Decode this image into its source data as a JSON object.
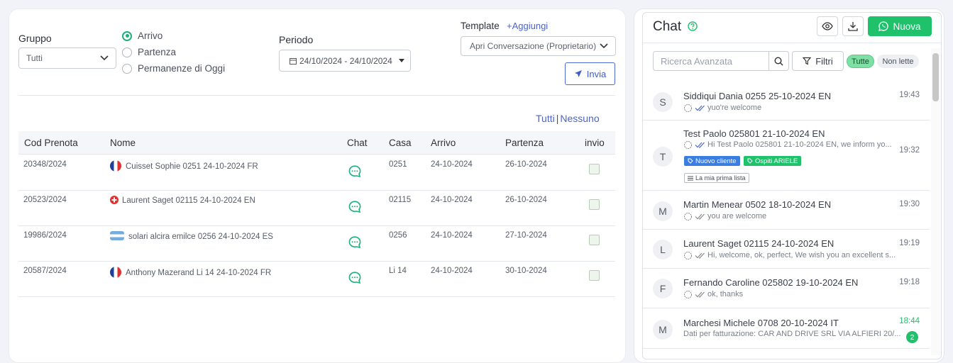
{
  "filters": {
    "gruppo_label": "Gruppo",
    "gruppo_value": "Tutti",
    "radios": [
      {
        "label": "Arrivo",
        "checked": true
      },
      {
        "label": "Partenza",
        "checked": false
      },
      {
        "label": "Permanenze di Oggi",
        "checked": false
      }
    ],
    "periodo_label": "Periodo",
    "periodo_value": "24/10/2024 - 24/10/2024",
    "template_label": "Template",
    "template_add": "+Aggiungi",
    "template_value": "Apri Conversazione (Proprietario)",
    "invia_label": "Invia"
  },
  "selection": {
    "all": "Tutti",
    "sep": "|",
    "none": "Nessuno"
  },
  "table": {
    "headers": [
      "Cod Prenota",
      "Nome",
      "Chat",
      "Casa",
      "Arrivo",
      "Partenza",
      "invio"
    ],
    "rows": [
      {
        "code": "20348/2024",
        "flag": "fr",
        "name": "Cuisset Sophie 0251 24-10-2024 FR",
        "casa": "0251",
        "arrivo": "24-10-2024",
        "partenza": "26-10-2024"
      },
      {
        "code": "20523/2024",
        "flag": "ch",
        "name": "Laurent Saget 02115 24-10-2024 EN",
        "casa": "02115",
        "arrivo": "24-10-2024",
        "partenza": "26-10-2024"
      },
      {
        "code": "19986/2024",
        "flag": "ar",
        "name": "solari alcira emilce 0256 24-10-2024 ES",
        "casa": "0256",
        "arrivo": "24-10-2024",
        "partenza": "27-10-2024"
      },
      {
        "code": "20587/2024",
        "flag": "fr",
        "name": "Anthony Mazerand Li 14 24-10-2024 FR",
        "casa": "Li 14",
        "arrivo": "24-10-2024",
        "partenza": "30-10-2024"
      }
    ]
  },
  "chat": {
    "title": "Chat",
    "new_label": "Nuova",
    "search_placeholder": "Ricerca Avanzata",
    "filter_label": "Filtri",
    "pill_all": "Tutte",
    "pill_unread": "Non lette",
    "colors": {
      "green": "#1fc16b",
      "blue": "#4a64c8"
    },
    "conversations": [
      {
        "initial": "S",
        "name": "Siddiqui Dania 0255 25-10-2024 EN",
        "message": "yuo're welcome",
        "time": "19:43"
      },
      {
        "initial": "T",
        "name": "Test Paolo 025801 21-10-2024 EN",
        "message": "Hi Test Paolo 025801 21-10-2024 EN, we inform yo...",
        "time": "19:32",
        "tags": [
          "Nuovo cliente",
          "Ospiti ARIELE"
        ],
        "list_tag": "La mia prima lista"
      },
      {
        "initial": "M",
        "name": "Martin Menear 0502 18-10-2024 EN",
        "message": "you are welcome",
        "time": "19:30"
      },
      {
        "initial": "L",
        "name": "Laurent Saget 02115 24-10-2024 EN",
        "message": "Hi, welcome, ok, perfect, We wish you an excellent s...",
        "time": "19:19"
      },
      {
        "initial": "F",
        "name": "Fernando Caroline 025802 19-10-2024 EN",
        "message": "ok, thanks",
        "time": "19:18"
      },
      {
        "initial": "M",
        "name": "Marchesi Michele 0708 20-10-2024 IT",
        "message": "Dati per fatturazione: CAR AND DRIVE SRL VIA ALFIERI 20/...",
        "time": "18:44",
        "badge": "2"
      }
    ]
  }
}
